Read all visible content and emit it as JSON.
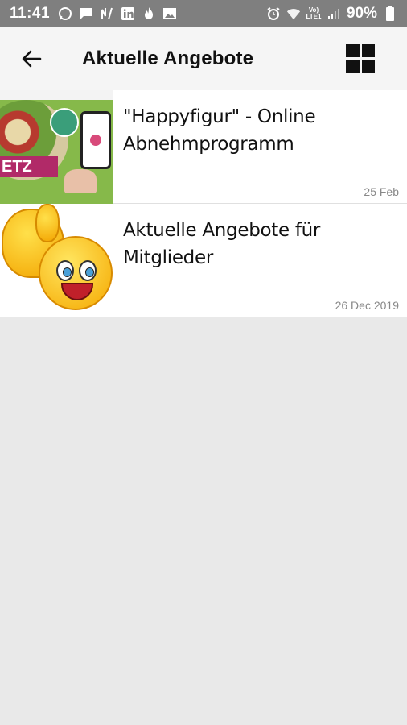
{
  "status_bar": {
    "time": "11:41",
    "battery": "90%",
    "left_icons": [
      "whatsapp-icon",
      "message-icon",
      "n-icon",
      "linkedin-icon",
      "fire-icon",
      "image-icon"
    ],
    "right_icons": [
      "alarm-icon",
      "wifi-icon",
      "volte-icon",
      "signal-icon",
      "battery-icon"
    ]
  },
  "app_bar": {
    "title": "Aktuelle Angebote",
    "back_icon": "arrow-left-icon",
    "view_icon": "grid-view-icon"
  },
  "items": [
    {
      "title": "\"Happyfigur\" - Online Abnehmprogramm",
      "date": "25 Feb",
      "thumb_banner": "ETZ"
    },
    {
      "title": "Aktuelle Angebote für Mitglieder",
      "date": "26 Dec 2019"
    }
  ]
}
